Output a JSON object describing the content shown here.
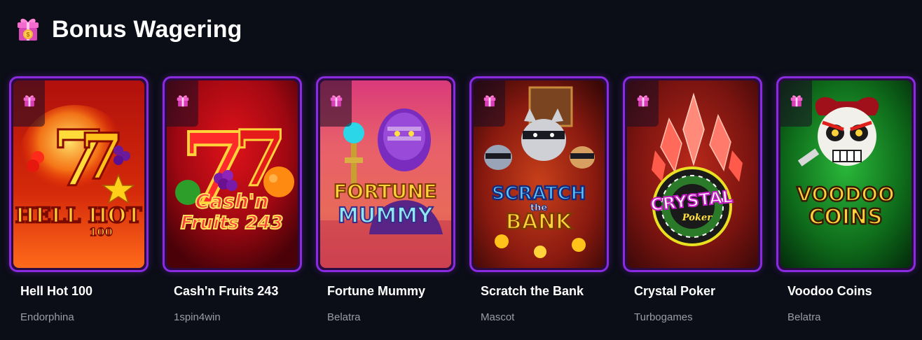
{
  "section": {
    "title": "Bonus Wagering",
    "icon": "gift-coin-icon"
  },
  "games": [
    {
      "title": "Hell Hot 100",
      "provider": "Endorphina",
      "art_logo": "HELL HOT",
      "art_sub": "100",
      "badge_icon": "gift-icon"
    },
    {
      "title": "Cash'n Fruits 243",
      "provider": "1spin4win",
      "art_logo": "Cash'n",
      "art_sub": "Fruits 243",
      "badge_icon": "gift-icon"
    },
    {
      "title": "Fortune Mummy",
      "provider": "Belatra",
      "art_logo": "FORTUNE",
      "art_sub": "MUMMY",
      "badge_icon": "gift-icon"
    },
    {
      "title": "Scratch the Bank",
      "provider": "Mascot",
      "art_logo": "SCRATCH",
      "art_mid": "the",
      "art_sub": "BANK",
      "badge_icon": "gift-icon"
    },
    {
      "title": "Crystal Poker",
      "provider": "Turbogames",
      "art_logo": "CRYSTAL",
      "art_sub": "Poker",
      "badge_icon": "gift-icon"
    },
    {
      "title": "Voodoo Coins",
      "provider": "Belatra",
      "art_logo": "VOODOO",
      "art_sub": "COINS",
      "badge_icon": "gift-icon"
    }
  ],
  "colors": {
    "background": "#0b0d17",
    "card_border": "#8a2be2",
    "provider_text": "#9a9ca8",
    "gift_badge": "#e94ec8"
  }
}
